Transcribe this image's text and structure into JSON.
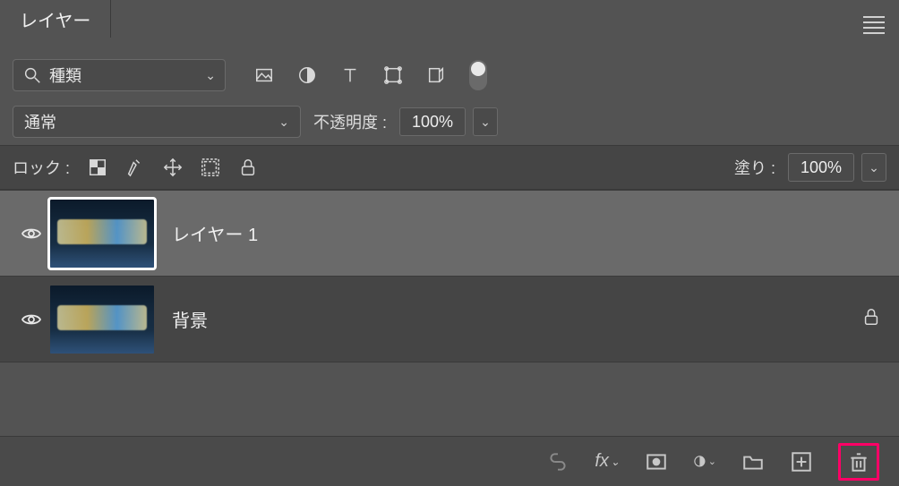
{
  "panel": {
    "title": "レイヤー"
  },
  "filter": {
    "kind_label": "種類"
  },
  "blend": {
    "mode": "通常",
    "opacity_label": "不透明度 :",
    "opacity": "100%"
  },
  "lock": {
    "label": "ロック :",
    "fill_label": "塗り :",
    "fill": "100%"
  },
  "layers": [
    {
      "name": "レイヤー 1",
      "selected": true,
      "locked": false
    },
    {
      "name": "背景",
      "selected": false,
      "locked": true
    }
  ],
  "fx_label": "fx"
}
